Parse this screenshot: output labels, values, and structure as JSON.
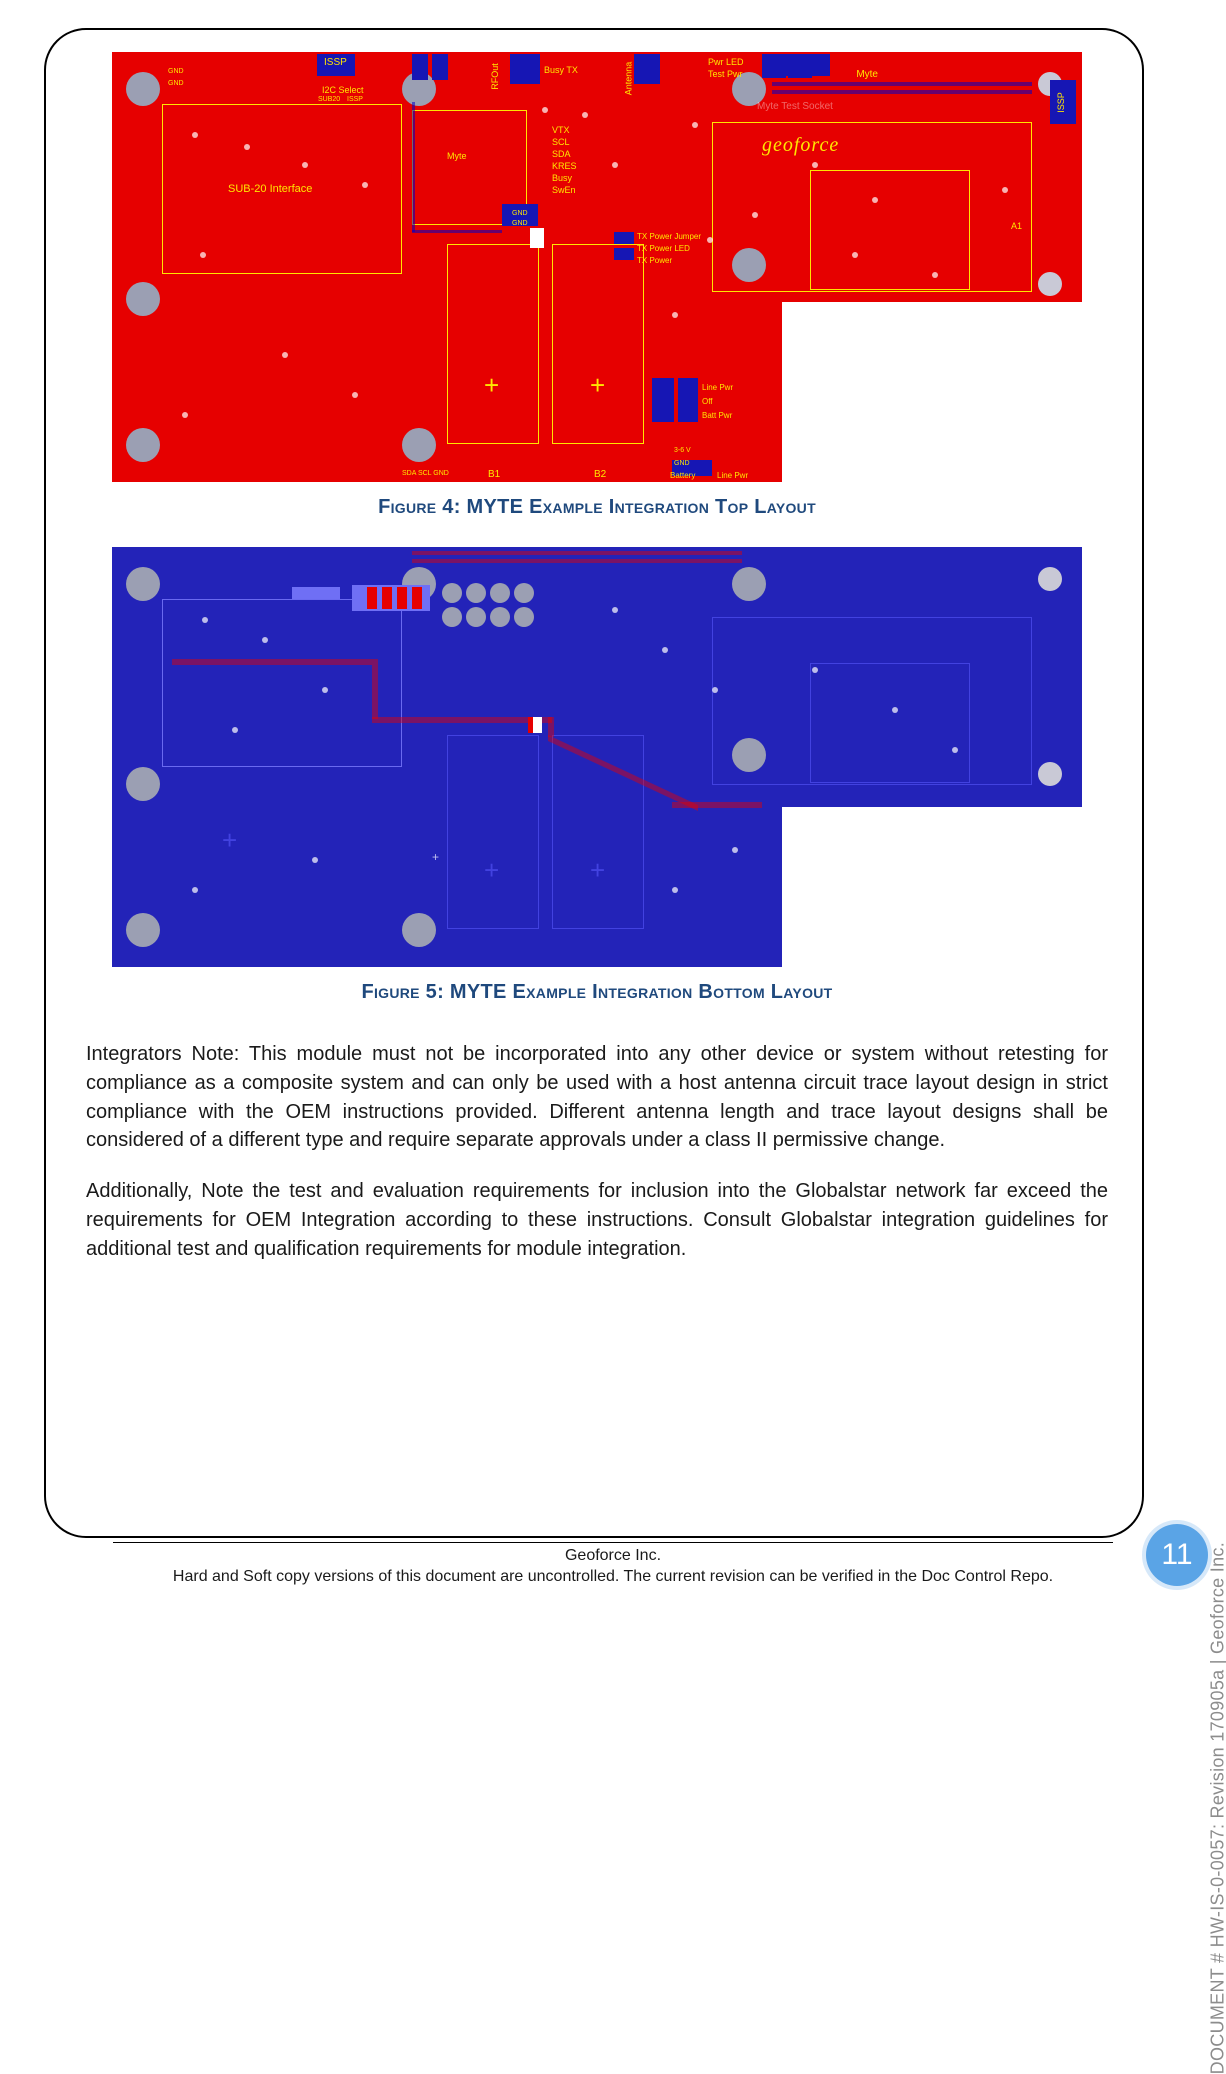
{
  "figure4": {
    "caption": "Figure 4: MYTE Example Integration Top Layout",
    "silkscreen": {
      "issp": "ISSP",
      "i2c_select": "I2C Select",
      "sub20_interface": "SUB-20 Interface",
      "sub20": "SUB20",
      "issp_small": "ISSP",
      "rfout": "RFOut",
      "busy_tx": "Busy TX",
      "antenna": "Antenna",
      "myte": "Myte",
      "pwr_led": "Pwr LED",
      "test_pwr": "Test Pwr",
      "myte_test_socket": "Myte Test Socket",
      "issp_right": "ISSP",
      "a1": "A1",
      "vtx": "VTX",
      "scl": "SCL",
      "sda": "SDA",
      "kres": "KRES",
      "busy": "Busy",
      "swen": "SwEn",
      "gnd_top": "GND",
      "gnd_top2": "GND",
      "gnd_mid": "GND",
      "gnd_mid2": "GND",
      "tx_power_jumper": "TX Power Jumper",
      "tx_power_led": "TX Power LED",
      "tx_power": "TX Power",
      "line_pwr": "Line Pwr",
      "off": "Off",
      "batt_pwr": "Batt Pwr",
      "v_3_6": "3-6 V",
      "gnd_bot": "GND",
      "battery": "Battery",
      "line_pwr_label": "Line Pwr",
      "b1": "B1",
      "b2": "B2",
      "sda_scl_small": "SDA SCL GND",
      "brand": "geoforce"
    }
  },
  "figure5": {
    "caption": "Figure 5: MYTE Example Integration Bottom Layout"
  },
  "note1": "Integrators Note: This module must not be incorporated into any other device or system without retesting for compliance as a composite system and can only be used with a host antenna circuit trace layout design in strict compliance with the OEM instructions provided.  Different antenna length and trace layout designs shall be considered of a different type and require separate approvals under a class II permissive change.",
  "note2": "Additionally, Note the test and evaluation requirements for inclusion into the Globalstar network far exceed the requirements for OEM Integration according to these instructions. Consult Globalstar integration guidelines for additional test and qualification requirements for module integration.",
  "side_label": "DOCUMENT # HW-IS-0-0057: Revision 170905a | Geoforce Inc.",
  "footer": {
    "company": "Geoforce Inc.",
    "disclaimer": "Hard and Soft copy versions of this document are uncontrolled. The current revision can be verified in the Doc Control Repo."
  },
  "page_number": "11"
}
